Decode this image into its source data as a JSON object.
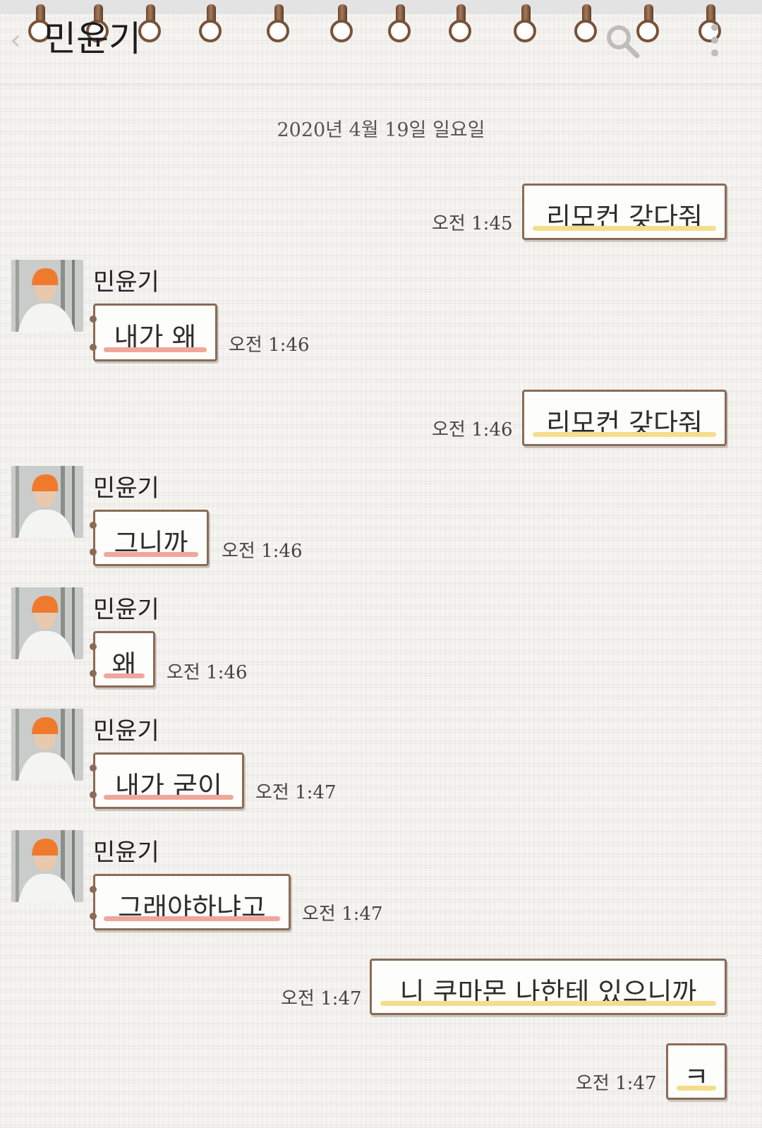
{
  "header": {
    "back_icon": "chevron-left-icon",
    "title": "민윤기",
    "search_icon": "search-icon",
    "more_icon": "more-vertical-icon"
  },
  "date_divider": "2020년 4월 19일 일요일",
  "contact": {
    "name": "민윤기"
  },
  "messages": [
    {
      "from": "me",
      "text": "리모컨 갖다줘",
      "time": "오전 1:45"
    },
    {
      "from": "them",
      "text": "내가 왜",
      "time": "오전 1:46"
    },
    {
      "from": "me",
      "text": "리모컨 갖다줘",
      "time": "오전 1:46"
    },
    {
      "from": "them",
      "text": "그니까",
      "time": "오전 1:46"
    },
    {
      "from": "them",
      "text": "왜",
      "time": "오전 1:46"
    },
    {
      "from": "them",
      "text": "내가 굳이",
      "time": "오전 1:47"
    },
    {
      "from": "them",
      "text": "그래야하냐고",
      "time": "오전 1:47"
    },
    {
      "from": "me",
      "text": "니 쿠마몬 나한테 있으니까",
      "time": "오전 1:47"
    },
    {
      "from": "me",
      "text": "ㅋ",
      "time": "오전 1:47"
    }
  ],
  "colors": {
    "my_underline": "#f5dd8c",
    "their_underline": "#f0a79b",
    "bubble_border": "#8a6b55"
  }
}
